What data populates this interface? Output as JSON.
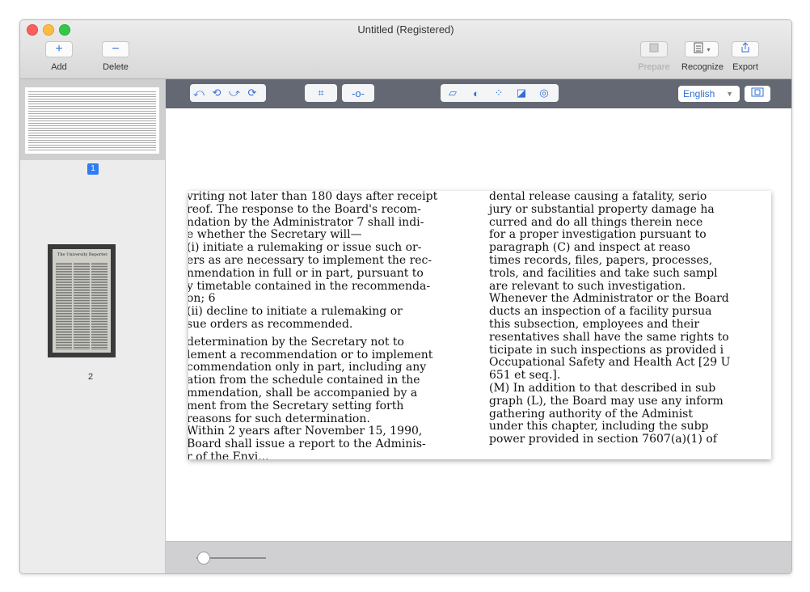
{
  "window": {
    "title": "Untitled (Registered)"
  },
  "toolbar": {
    "add_label": "Add",
    "delete_label": "Delete",
    "prepare_label": "Prepare",
    "recognize_label": "Recognize",
    "export_label": "Export"
  },
  "sidebar": {
    "pages": [
      {
        "number": "1",
        "selected": true
      },
      {
        "number": "2",
        "selected": false
      }
    ],
    "thumb2_masthead": "The University Reporter."
  },
  "edit_toolbar": {
    "language": "English",
    "icons": [
      "rotate-left-icon",
      "rotate-left-alt-icon",
      "rotate-right-icon",
      "rotate-right-alt-icon",
      "crop-icon",
      "straighten-icon",
      "deskew-icon",
      "contrast-icon",
      "noise-icon",
      "invert-icon",
      "auto-enhance-icon",
      "layout-icon"
    ]
  },
  "document": {
    "left_column": [
      "vriting not later than 180 days after receipt",
      "reof. The response to the Board's recom-",
      "ndation by the Administrator 7 shall indi-",
      "e whether the Secretary will—",
      "(i) initiate a rulemaking or issue such or-",
      "ers as are necessary to implement the rec-",
      "nmendation in full or in part, pursuant to",
      "y timetable contained in the recommenda-",
      "on; 6",
      "(ii) decline to initiate a rulemaking or",
      "sue orders as recommended.",
      "",
      " determination by the Secretary not to",
      "lement a recommendation or to implement",
      "commendation only in part, including any",
      "ation from the schedule contained in the",
      "mmendation, shall be accompanied by a",
      "ment from the Secretary setting forth",
      "reasons for such determination.",
      " Within 2 years after November 15, 1990,",
      "Board shall issue a report to the Adminis-",
      "r of the Envi..."
    ],
    "right_column": [
      "  dental release causing a fatality, serio",
      "  jury or substantial property damage ha",
      "  curred and do all things therein nece",
      "  for a proper investigation pursuant to",
      "  paragraph (C) and inspect at reaso",
      "  times records, files, papers, processes,",
      "  trols, and facilities and take such sampl",
      "  are relevant to such investigation.",
      "Whenever the Administrator or the Board",
      "ducts an inspection of a facility pursua",
      "this subsection, employees and their",
      "resentatives shall have the same rights to",
      "ticipate in such inspections as provided i",
      "Occupational Safety and Health Act [29 U",
      "651 et seq.].",
      "  (M) In addition to that described in sub",
      "graph (L), the Board may use any inform",
      "gathering authority of the Administ",
      "under this chapter, including the subp",
      "power provided in section 7607(a)(1) of"
    ]
  },
  "zoom": {
    "level": 0.1
  }
}
